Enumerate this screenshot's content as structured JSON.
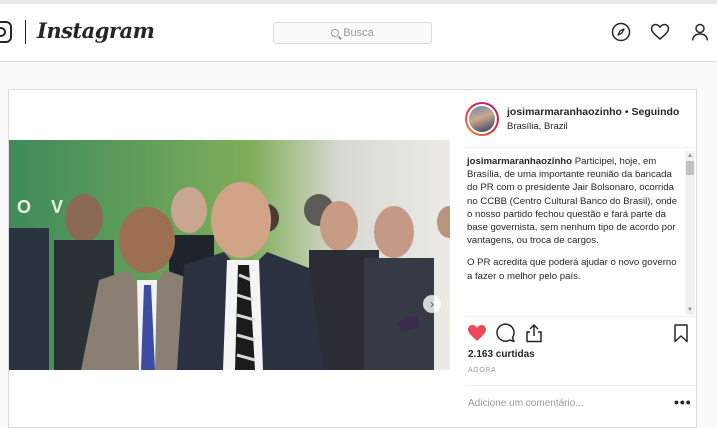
{
  "app": {
    "name": "Instagram"
  },
  "search": {
    "placeholder": "Busca"
  },
  "nav_icons": [
    "compass-icon",
    "heart-icon",
    "user-icon"
  ],
  "post": {
    "username": "josimarmaranhaozinho",
    "separator": "•",
    "follow_status": "Seguindo",
    "location": "Brasília, Brazil",
    "caption_user": "josimarmaranhaozinho",
    "caption_p1": "Participei, hoje, em Brasília, de uma importante reunião da bancada do PR com o presidente Jair Bolsonaro, ocorrida no CCBB (Centro Cultural Banco do Brasil), onde o nosso partido fechou questão e fará parte da base governista, sem nenhum tipo de acordo por vantagens, ou troca de cargos.",
    "caption_p2": "O PR acredita que poderá ajudar o novo governo a fazer o melhor pelo país.",
    "likes": "2.163 curtidas",
    "date": "AGORA",
    "comment_placeholder": "Adicione um comentário...",
    "more": "•••",
    "next_arrow": "›",
    "liked": true
  },
  "colors": {
    "like": "#ed4956",
    "accent": "#3897f0",
    "border": "#dbdbdb"
  }
}
